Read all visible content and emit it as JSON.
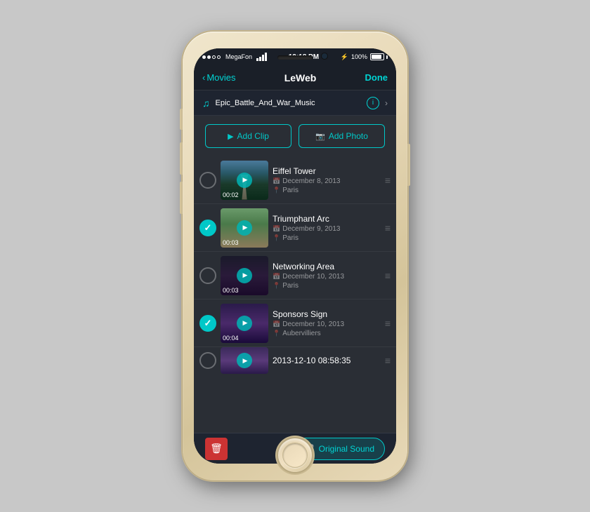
{
  "status_bar": {
    "dots": [
      true,
      true,
      false,
      false
    ],
    "carrier": "MegaFon",
    "wifi_icon": "📶",
    "time": "12:18 PM",
    "bluetooth_icon": "🔷",
    "battery_icon": "🔋",
    "battery_percent": "100%"
  },
  "nav": {
    "back_label": "Movies",
    "title": "LeWeb",
    "done_label": "Done"
  },
  "music": {
    "track_name": "Epic_Battle_And_War_Music"
  },
  "actions": {
    "add_clip_label": "Add Clip",
    "add_photo_label": "Add Photo"
  },
  "videos": [
    {
      "title": "Eiffel Tower",
      "date": "December 8, 2013",
      "location": "Paris",
      "duration": "00:02",
      "checked": false,
      "thumb_class": "thumb-eiffel"
    },
    {
      "title": "Triumphant Arc",
      "date": "December 9, 2013",
      "location": "Paris",
      "duration": "00:03",
      "checked": true,
      "thumb_class": "thumb-arc"
    },
    {
      "title": "Networking Area",
      "date": "December 10, 2013",
      "location": "Paris",
      "duration": "00:03",
      "checked": false,
      "thumb_class": "thumb-network"
    },
    {
      "title": "Sponsors Sign",
      "date": "December 10, 2013",
      "location": "Aubervilliers",
      "duration": "00:04",
      "checked": true,
      "thumb_class": "thumb-sponsors"
    },
    {
      "title": "2013-12-10 08:58:35",
      "date": "",
      "location": "",
      "duration": "",
      "checked": false,
      "thumb_class": "thumb-last"
    }
  ],
  "toolbar": {
    "original_sound_label": "Original Sound"
  }
}
